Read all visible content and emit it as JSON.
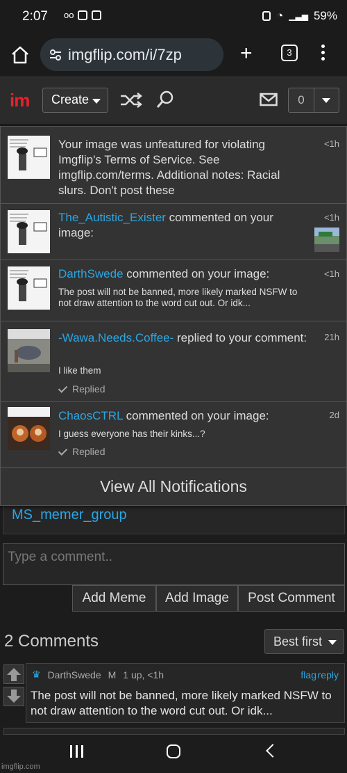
{
  "status": {
    "time": "2:07",
    "battery": "59%"
  },
  "browser": {
    "url": "imgflip.com/i/7zp",
    "tab_count": "3"
  },
  "header": {
    "logo": "im",
    "create_label": "Create",
    "notif_count": "0"
  },
  "notifications": [
    {
      "text": "Your image was unfeatured for violating Imgflip's Terms of Service. See imgflip.com/terms. Additional notes: Racial slurs. Don't post these",
      "time": "<1h"
    },
    {
      "user": "The_Autistic_Exister",
      "action": " commented on your image:",
      "time": "<1h"
    },
    {
      "user": "DarthSwede",
      "action": " commented on your image:",
      "comment": "The post will not be banned, more likely marked NSFW to not draw attention to the word cut out. Or idk...",
      "time": "<1h"
    },
    {
      "user": "-Wawa.Needs.Coffee-",
      "action": " replied to your comment:",
      "comment": "I like them",
      "status": "Replied",
      "time": "21h"
    },
    {
      "user": "ChaosCTRL",
      "action": " commented on your image:",
      "comment": "I guess everyone has their kinks...?",
      "status": "Replied",
      "time": "2d"
    }
  ],
  "view_all_label": "View All Notifications",
  "page": {
    "group_link": "MS_memer_group",
    "comment_placeholder": "Type a comment..",
    "buttons": {
      "add_meme": "Add Meme",
      "add_image": "Add Image",
      "post_comment": "Post Comment"
    },
    "comments_title": "2 Comments",
    "sort_label": "Best first",
    "comment": {
      "author": "DarthSwede",
      "badge": "M",
      "meta": "1 up, <1h",
      "flag": "flag",
      "reply": "reply",
      "text": "The post will not be banned, more likely marked NSFW to not draw attention to the word cut out. Or idk..."
    }
  },
  "watermark": "imgflip.com"
}
